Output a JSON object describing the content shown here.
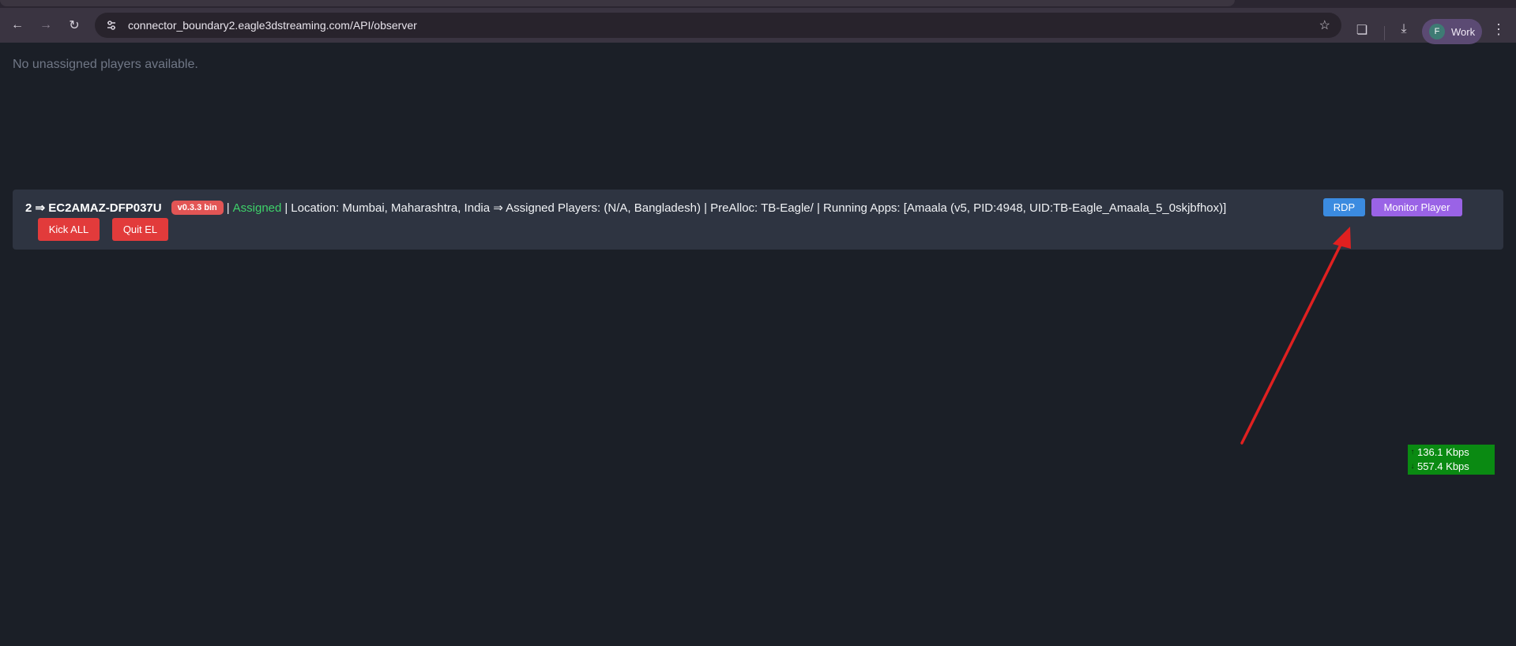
{
  "browser": {
    "url": "connector_boundary2.eagle3dstreaming.com/API/observer",
    "profile_initial": "F",
    "profile_name": "Work"
  },
  "page": {
    "empty_message": "No unassigned players available."
  },
  "server": {
    "title": "2 ⇒ EC2AMAZ-DFP037U",
    "version": "v0.3.3 bin",
    "status": "Assigned",
    "details": "Location: Mumbai, Maharashtra, India ⇒ Assigned Players: (N/A, Bangladesh) | PreAlloc: TB-Eagle/ | Running Apps: [Amaala (v5, PID:4948, UID:TB-Eagle_Amaala_5_0skjbfhox)]",
    "buttons": {
      "rdp": "RDP",
      "monitor": "Monitor Player",
      "kick": "Kick ALL",
      "quit": "Quit EL"
    }
  },
  "net_meter": {
    "upload": "136.1 Kbps",
    "download": "557.4 Kbps"
  },
  "colors": {
    "background": "#1b1f27",
    "card": "#2e3441",
    "assigned": "#3ed26a",
    "badge": "#e25555",
    "rdp": "#3b8be0",
    "monitor": "#9a63e6",
    "danger": "#e23b3b",
    "annotation_arrow": "#e02020",
    "meter": "#0a8a12"
  }
}
